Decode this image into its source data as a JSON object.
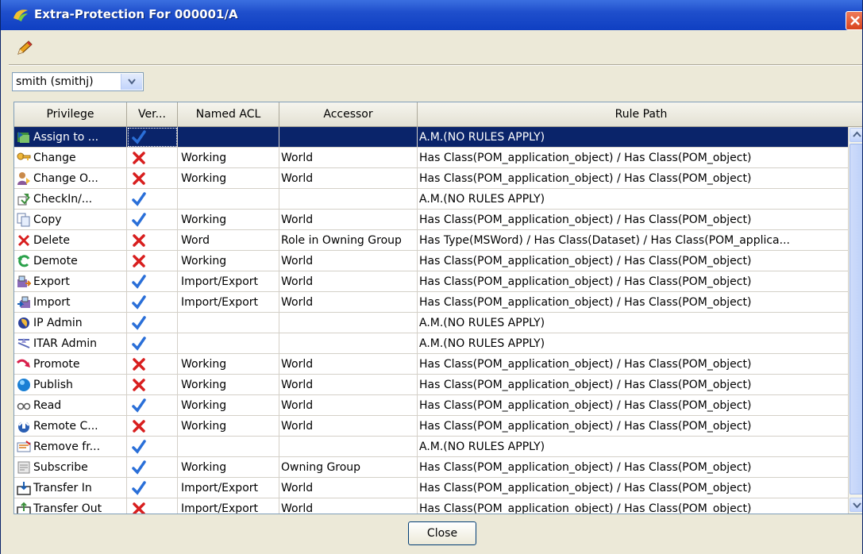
{
  "window": {
    "title": "Extra-Protection For 000001/A"
  },
  "toolbar": {
    "edit_icon": "pencil-icon"
  },
  "user_select": {
    "value": "smith (smithj)"
  },
  "table": {
    "columns": [
      "Privilege",
      "Ver...",
      "Named ACL",
      "Accessor",
      "Rule Path"
    ],
    "rows": [
      {
        "privilege": "Assign to ...",
        "icon": "assign-icon",
        "verdict": "check",
        "acl": "",
        "accessor": "",
        "rule": "A.M.(NO RULES APPLY)",
        "selected": true
      },
      {
        "privilege": "Change",
        "icon": "key-icon",
        "verdict": "cross",
        "acl": "Working",
        "accessor": "World",
        "rule": "Has Class(POM_application_object) / Has Class(POM_object)"
      },
      {
        "privilege": "Change O...",
        "icon": "user-change-icon",
        "verdict": "cross",
        "acl": "Working",
        "accessor": "World",
        "rule": "Has Class(POM_application_object) / Has Class(POM_object)"
      },
      {
        "privilege": "CheckIn/...",
        "icon": "checkin-icon",
        "verdict": "check",
        "acl": "",
        "accessor": "",
        "rule": "A.M.(NO RULES APPLY)"
      },
      {
        "privilege": "Copy",
        "icon": "copy-icon",
        "verdict": "check",
        "acl": "Working",
        "accessor": "World",
        "rule": "Has Class(POM_application_object) / Has Class(POM_object)"
      },
      {
        "privilege": "Delete",
        "icon": "delete-icon",
        "verdict": "cross",
        "acl": "Word",
        "accessor": "Role in Owning Group",
        "rule": "Has Type(MSWord) / Has Class(Dataset) / Has Class(POM_applica..."
      },
      {
        "privilege": "Demote",
        "icon": "demote-icon",
        "verdict": "cross",
        "acl": "Working",
        "accessor": "World",
        "rule": "Has Class(POM_application_object) / Has Class(POM_object)"
      },
      {
        "privilege": "Export",
        "icon": "export-icon",
        "verdict": "check",
        "acl": "Import/Export",
        "accessor": "World",
        "rule": "Has Class(POM_application_object) / Has Class(POM_object)"
      },
      {
        "privilege": "Import",
        "icon": "import-icon",
        "verdict": "check",
        "acl": "Import/Export",
        "accessor": "World",
        "rule": "Has Class(POM_application_object) / Has Class(POM_object)"
      },
      {
        "privilege": "IP Admin",
        "icon": "ip-admin-icon",
        "verdict": "check",
        "acl": "",
        "accessor": "",
        "rule": "A.M.(NO RULES APPLY)"
      },
      {
        "privilege": "ITAR Admin",
        "icon": "itar-admin-icon",
        "verdict": "check",
        "acl": "",
        "accessor": "",
        "rule": "A.M.(NO RULES APPLY)"
      },
      {
        "privilege": "Promote",
        "icon": "promote-icon",
        "verdict": "cross",
        "acl": "Working",
        "accessor": "World",
        "rule": "Has Class(POM_application_object) / Has Class(POM_object)"
      },
      {
        "privilege": "Publish",
        "icon": "globe-icon",
        "verdict": "cross",
        "acl": "Working",
        "accessor": "World",
        "rule": "Has Class(POM_application_object) / Has Class(POM_object)"
      },
      {
        "privilege": "Read",
        "icon": "glasses-icon",
        "verdict": "check",
        "acl": "Working",
        "accessor": "World",
        "rule": "Has Class(POM_application_object) / Has Class(POM_object)"
      },
      {
        "privilege": "Remote C...",
        "icon": "remote-icon",
        "verdict": "cross",
        "acl": "Working",
        "accessor": "World",
        "rule": "Has Class(POM_application_object) / Has Class(POM_object)"
      },
      {
        "privilege": "Remove fr...",
        "icon": "remove-icon",
        "verdict": "check",
        "acl": "",
        "accessor": "",
        "rule": "A.M.(NO RULES APPLY)"
      },
      {
        "privilege": "Subscribe",
        "icon": "subscribe-icon",
        "verdict": "check",
        "acl": "Working",
        "accessor": "Owning Group",
        "rule": "Has Class(POM_application_object) / Has Class(POM_object)"
      },
      {
        "privilege": "Transfer In",
        "icon": "transfer-in-icon",
        "verdict": "check",
        "acl": "Import/Export",
        "accessor": "World",
        "rule": "Has Class(POM_application_object) / Has Class(POM_object)"
      },
      {
        "privilege": "Transfer Out",
        "icon": "transfer-out-icon",
        "verdict": "cross",
        "acl": "Import/Export",
        "accessor": "World",
        "rule": "Has Class(POM_application_object) / Has Class(POM_object)"
      }
    ]
  },
  "footer": {
    "close_label": "Close"
  },
  "colors": {
    "titlebar": "#0f3fc2",
    "selected_row": "#0a246a",
    "check": "#2a6fd8",
    "cross": "#d81e1e"
  }
}
